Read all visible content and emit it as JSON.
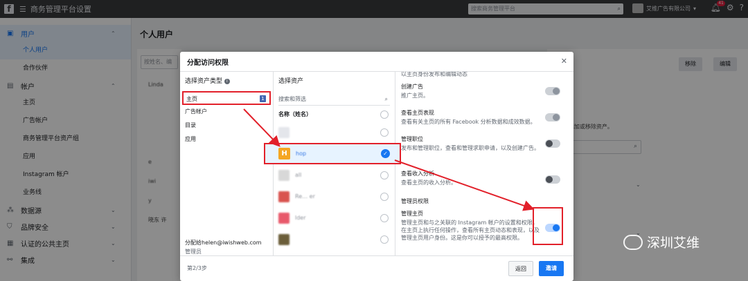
{
  "topbar": {
    "title": "商务管理平台设置",
    "search_placeholder": "搜索商务管理平台",
    "business_name": "艾维广告有限公司",
    "notification_count": "41"
  },
  "sidebar": {
    "sections": [
      {
        "label": "用户",
        "items": [
          "个人用户",
          "合作伙伴"
        ]
      },
      {
        "label": "帐户",
        "items": [
          "主页",
          "广告帐户",
          "商务管理平台资产组",
          "应用",
          "Instagram 帐户",
          "业务线"
        ]
      },
      {
        "label": "数据源"
      },
      {
        "label": "品牌安全"
      },
      {
        "label": "认证的公共主页"
      },
      {
        "label": "集成"
      }
    ]
  },
  "main": {
    "title": "个人用户",
    "search_placeholder": "按姓名、编",
    "people": [
      "Linda",
      "",
      "",
      "",
      "e",
      "iwi",
      "y",
      "晓东 许"
    ],
    "remove_label": "移除",
    "edit_label": "编辑",
    "hint_text": "为 TA 添加或移除资产。"
  },
  "modal": {
    "title": "分配访问权限",
    "col1_head": "选择资产类型",
    "asset_types": [
      {
        "label": "主页",
        "count": "1"
      },
      {
        "label": "广告帐户"
      },
      {
        "label": "目录"
      },
      {
        "label": "应用"
      }
    ],
    "assign_to": "分配给helen@iwishweb.com",
    "assign_role": "管理员",
    "col2_head": "选择资产",
    "asset_search_placeholder": "搜索和筛选",
    "name_column": "名称（姓名）",
    "assets": [
      {
        "name": "",
        "selected": false
      },
      {
        "name": "hop",
        "selected": true,
        "thumb": "H"
      },
      {
        "name": "all",
        "selected": false
      },
      {
        "name": "Re… er",
        "selected": false
      },
      {
        "name": "lder",
        "selected": false
      },
      {
        "name": "",
        "selected": false
      }
    ],
    "permissions": [
      {
        "title": "",
        "desc": "以主页身份发布和编辑动态"
      },
      {
        "title": "创建广告",
        "desc": "推广主页。",
        "state": "off"
      },
      {
        "title": "查看主页表现",
        "desc": "查看有关主页的所有 Facebook 分析数据和成效数据。",
        "state": "off"
      },
      {
        "title": "管理职位",
        "desc": "发布和管理职位，查看和管理求职申请，以及创建广告。",
        "state": "dark"
      },
      {
        "title": "查看收入分析",
        "desc": "查看主页的收入分析。",
        "state": "dark"
      },
      {
        "section": "管理员权限"
      },
      {
        "title": "管理主页",
        "desc": "管理主页和与之关联的 Instagram 帐户的设置和权限，在主页上执行任何操作，查看所有主页动态和表现，以及管理主页用户身份。这是你可以授予的最高权限。",
        "state": "on"
      }
    ],
    "step": "第2/3步",
    "back_label": "返回",
    "invite_label": "邀请",
    "close_icon": "close-icon"
  },
  "watermark": "深圳艾维",
  "colors": {
    "accent": "#1877f2",
    "highlight": "#e2202a",
    "topbar": "#3a3b3c"
  }
}
